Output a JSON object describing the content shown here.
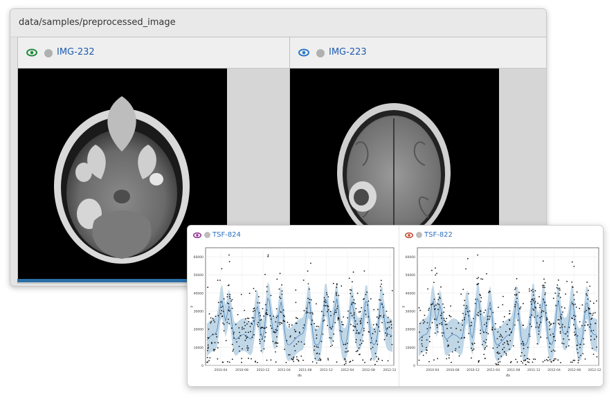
{
  "window": {
    "path": "data/samples/preprocessed_image"
  },
  "panes": [
    {
      "label": "IMG-232",
      "eye_color": "#1f8a3a"
    },
    {
      "label": "IMG-223",
      "eye_color": "#2a78c8"
    }
  ],
  "colors": {
    "link": "#1d5bb0",
    "accent_bar": "#2a6ea6",
    "band": "#b9d3e4"
  },
  "charts": [
    {
      "label": "TSF-824",
      "eye_color": "#8e2c8e"
    },
    {
      "label": "TSF-822",
      "eye_color": "#c2462a"
    }
  ],
  "chart_data": [
    {
      "type": "scatter",
      "title": "",
      "xlabel": "ds",
      "ylabel": "y",
      "ylim": [
        0,
        65000
      ],
      "yticks": [
        0,
        10000,
        20000,
        30000,
        40000,
        50000,
        60000
      ],
      "xtick_labels": [
        "2010-04",
        "2010-08",
        "2010-12",
        "2011-04",
        "2011-08",
        "2011-12",
        "2012-04",
        "2012-08",
        "2012-12"
      ],
      "grid": true
    },
    {
      "type": "scatter",
      "title": "",
      "xlabel": "ds",
      "ylabel": "y",
      "ylim": [
        0,
        65000
      ],
      "yticks": [
        0,
        10000,
        20000,
        30000,
        40000,
        50000,
        60000
      ],
      "xtick_labels": [
        "2010-04",
        "2010-08",
        "2010-12",
        "2011-04",
        "2011-08",
        "2011-12",
        "2012-04",
        "2012-08",
        "2012-12"
      ],
      "grid": true
    }
  ]
}
